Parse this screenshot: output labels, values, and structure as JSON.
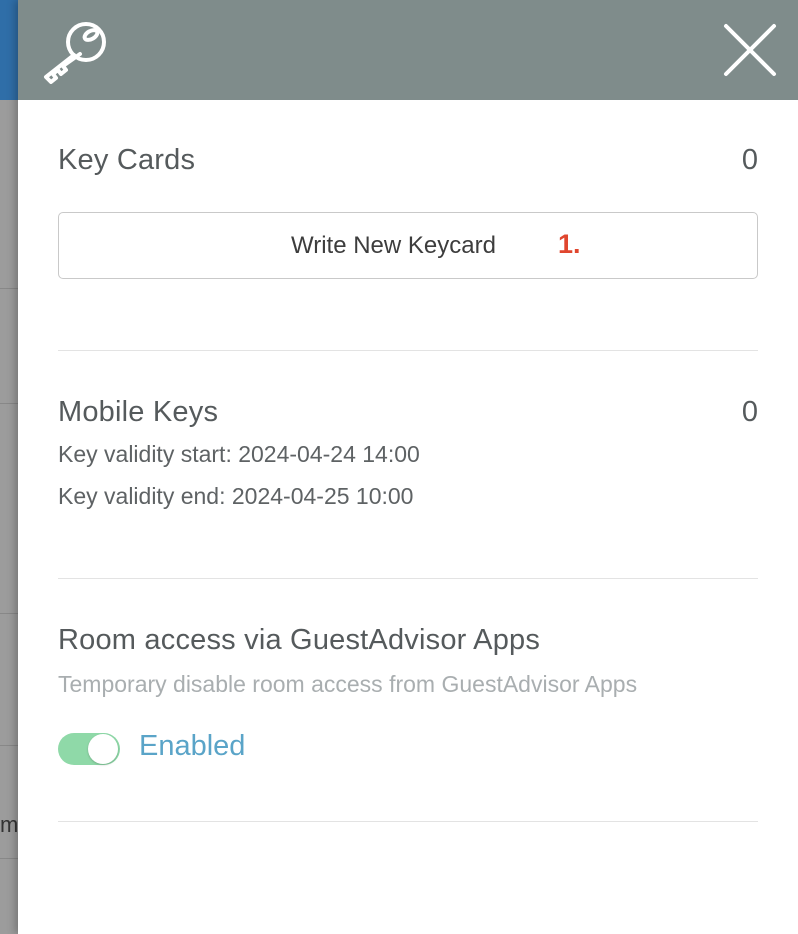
{
  "background": {
    "fragment_text": "m"
  },
  "header": {
    "icon": "key-icon",
    "close_icon": "close-icon",
    "background_color": "#7f8c8b"
  },
  "key_cards": {
    "title": "Key Cards",
    "count": "0",
    "write_button_label": "Write New Keycard",
    "step_marker": "1."
  },
  "mobile_keys": {
    "title": "Mobile Keys",
    "count": "0",
    "validity_start": "Key validity start: 2024-04-24 14:00",
    "validity_end": "Key validity end: 2024-04-25 10:00"
  },
  "room_access": {
    "title": "Room access via GuestAdvisor Apps",
    "subtitle": "Temporary disable room access from GuestAdvisor Apps",
    "toggle_state": "on",
    "toggle_label": "Enabled",
    "toggle_color": "#8fd9a8",
    "label_color": "#5aa4c8"
  },
  "colors": {
    "accent_red": "#e0462e"
  }
}
